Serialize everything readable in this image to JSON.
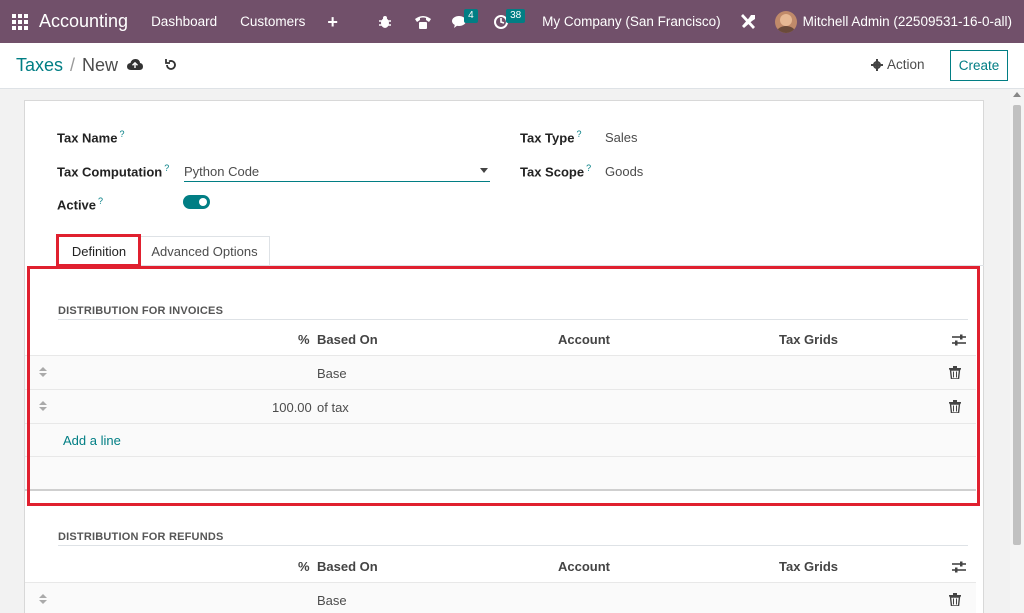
{
  "navbar": {
    "app_name": "Accounting",
    "menu": [
      "Dashboard",
      "Customers"
    ],
    "plus": "+",
    "messages_count": "4",
    "activities_count": "38",
    "company": "My Company (San Francisco)",
    "user": "Mitchell Admin (22509531-16-0-all)"
  },
  "breadcrumb": {
    "parent": "Taxes",
    "separator": "/",
    "current": "New"
  },
  "control_panel": {
    "action_label": "Action",
    "create_label": "Create"
  },
  "form": {
    "tax_name_label": "Tax Name",
    "tax_computation_label": "Tax Computation",
    "tax_computation_value": "Python Code",
    "active_label": "Active",
    "active_value": true,
    "tax_type_label": "Tax Type",
    "tax_type_value": "Sales",
    "tax_scope_label": "Tax Scope",
    "tax_scope_value": "Goods",
    "help_mark": "?"
  },
  "tabs": [
    {
      "label": "Definition",
      "active": true
    },
    {
      "label": "Advanced Options",
      "active": false
    }
  ],
  "invoices": {
    "title": "DISTRIBUTION FOR INVOICES",
    "headers": {
      "percent": "%",
      "based_on": "Based On",
      "account": "Account",
      "tax_grids": "Tax Grids"
    },
    "rows": [
      {
        "percent": "",
        "based_on": "Base",
        "account": "",
        "tax_grids": ""
      },
      {
        "percent": "100.00",
        "based_on": "of tax",
        "account": "",
        "tax_grids": ""
      }
    ],
    "add_line": "Add a line"
  },
  "refunds": {
    "title": "DISTRIBUTION FOR REFUNDS",
    "headers": {
      "percent": "%",
      "based_on": "Based On",
      "account": "Account",
      "tax_grids": "Tax Grids"
    },
    "rows": [
      {
        "percent": "",
        "based_on": "Base",
        "account": "",
        "tax_grids": ""
      }
    ]
  },
  "colors": {
    "navbar": "#71506a",
    "accent": "#017e84",
    "highlight": "#e0202f"
  }
}
